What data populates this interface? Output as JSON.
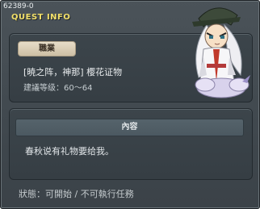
{
  "window": {
    "quest_id": "62389-0",
    "title": "QUEST INFO"
  },
  "info": {
    "job_label": "職業",
    "quest_name": "[暁之阵，神那] 樱花证物",
    "level_range": "建議等级：60～64"
  },
  "content": {
    "header": "內容",
    "text": "春秋说有礼物要给我。"
  },
  "status": {
    "text": "狀態：可開始 / 不可執行任務"
  },
  "npc": {
    "icon": "npc-ninja-portrait"
  },
  "colors": {
    "title": "#f2e06a",
    "window_bg": "#444c52",
    "badge_bg": "#ddd2bb"
  }
}
